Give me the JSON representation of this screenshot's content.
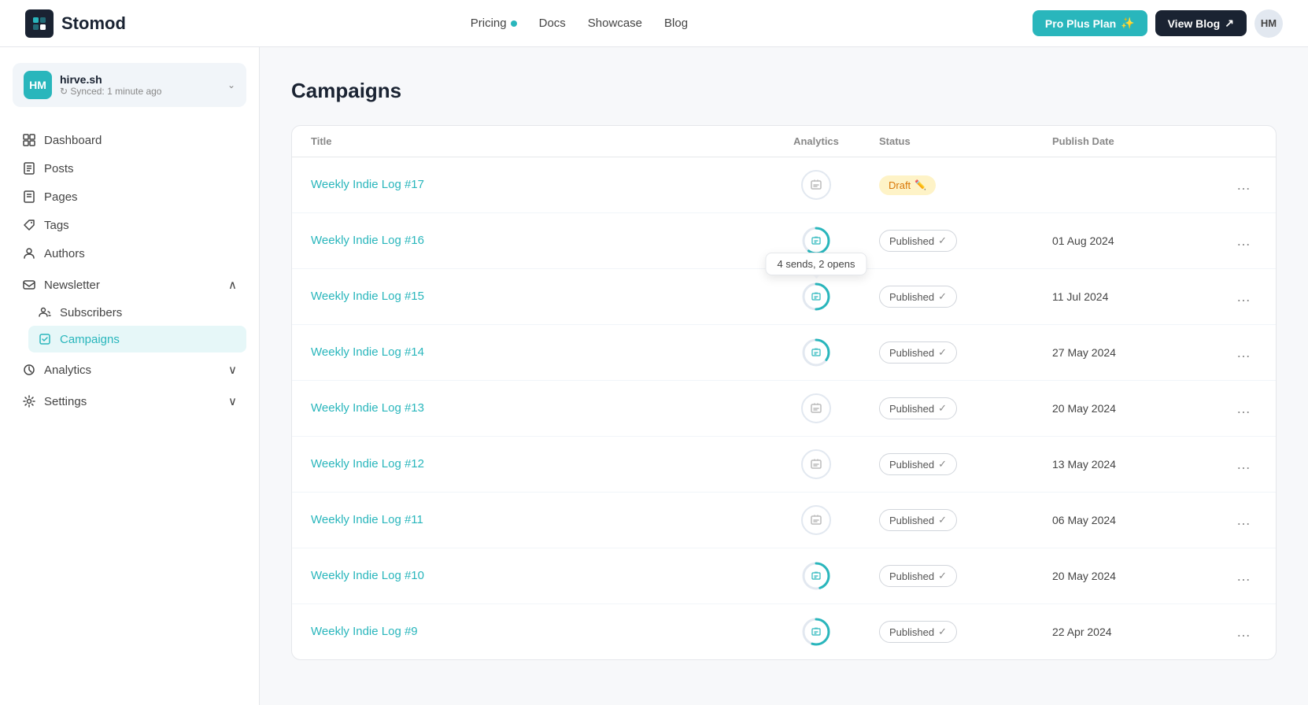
{
  "topnav": {
    "logo_text": "Stomod",
    "links": [
      {
        "label": "Pricing",
        "has_dot": true
      },
      {
        "label": "Docs",
        "has_dot": false
      },
      {
        "label": "Showcase",
        "has_dot": false
      },
      {
        "label": "Blog",
        "has_dot": false
      }
    ],
    "btn_pro": "Pro Plus Plan",
    "btn_view_blog": "View Blog",
    "avatar": "HM"
  },
  "sidebar": {
    "site_name": "hirve.sh",
    "site_sync": "Synced: 1 minute ago",
    "site_avatar": "HM",
    "nav_items": [
      {
        "label": "Dashboard",
        "icon": "grid",
        "active": false
      },
      {
        "label": "Posts",
        "icon": "file",
        "active": false
      },
      {
        "label": "Pages",
        "icon": "file-text",
        "active": false
      },
      {
        "label": "Tags",
        "icon": "tag",
        "active": false
      },
      {
        "label": "Authors",
        "icon": "user",
        "active": false
      }
    ],
    "newsletter_group": {
      "label": "Newsletter",
      "expanded": true,
      "children": [
        {
          "label": "Subscribers",
          "active": false
        },
        {
          "label": "Campaigns",
          "active": true
        }
      ]
    },
    "analytics": {
      "label": "Analytics",
      "expanded": false
    },
    "settings": {
      "label": "Settings",
      "expanded": false
    }
  },
  "main": {
    "page_title": "Campaigns",
    "table": {
      "headers": [
        "Title",
        "Analytics",
        "Status",
        "Publish Date",
        ""
      ],
      "rows": [
        {
          "title": "Weekly Indie Log #17",
          "analytics_type": "plain",
          "status": "draft",
          "status_label": "Draft",
          "publish_date": ""
        },
        {
          "title": "Weekly Indie Log #16",
          "analytics_type": "ring",
          "ring_pct": 60,
          "status": "published",
          "status_label": "Published",
          "publish_date": "01 Aug 2024"
        },
        {
          "title": "Weekly Indie Log #15",
          "analytics_type": "ring",
          "ring_pct": 50,
          "tooltip": "4 sends, 2 opens",
          "show_tooltip": true,
          "status": "published",
          "status_label": "Published",
          "publish_date": "11 Jul 2024"
        },
        {
          "title": "Weekly Indie Log #14",
          "analytics_type": "ring",
          "ring_pct": 35,
          "status": "published",
          "status_label": "Published",
          "publish_date": "27 May 2024"
        },
        {
          "title": "Weekly Indie Log #13",
          "analytics_type": "plain",
          "status": "published",
          "status_label": "Published",
          "publish_date": "20 May 2024"
        },
        {
          "title": "Weekly Indie Log #12",
          "analytics_type": "plain",
          "status": "published",
          "status_label": "Published",
          "publish_date": "13 May 2024"
        },
        {
          "title": "Weekly Indie Log #11",
          "analytics_type": "plain",
          "status": "published",
          "status_label": "Published",
          "publish_date": "06 May 2024"
        },
        {
          "title": "Weekly Indie Log #10",
          "analytics_type": "ring",
          "ring_pct": 45,
          "status": "published",
          "status_label": "Published",
          "publish_date": "20 May 2024"
        },
        {
          "title": "Weekly Indie Log #9",
          "analytics_type": "ring",
          "ring_pct": 55,
          "status": "published",
          "status_label": "Published",
          "publish_date": "22 Apr 2024"
        }
      ]
    }
  }
}
